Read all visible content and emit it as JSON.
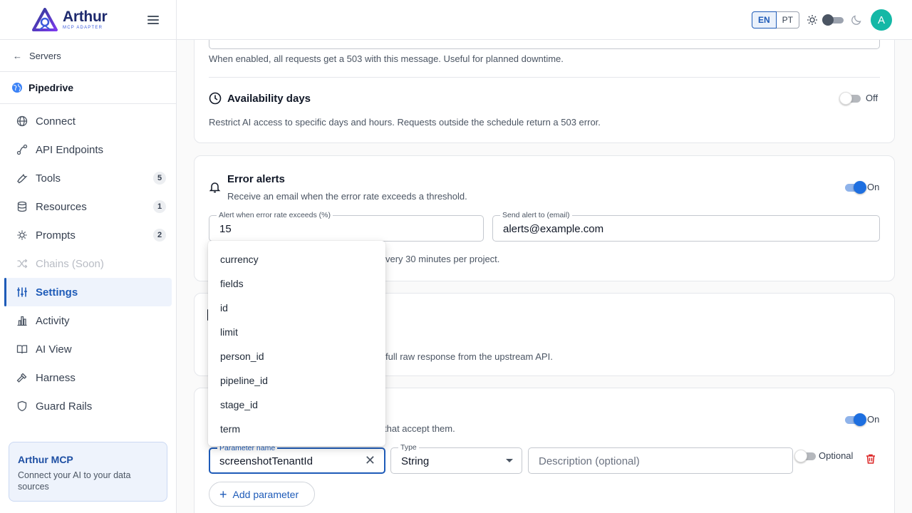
{
  "brand": {
    "title": "Arthur",
    "subtitle": "MCP ADAPTER"
  },
  "sidebar": {
    "back_label": "Servers",
    "server_name": "Pipedrive",
    "items": [
      {
        "label": "Connect",
        "icon": "globe-icon"
      },
      {
        "label": "API Endpoints",
        "icon": "endpoints-icon"
      },
      {
        "label": "Tools",
        "icon": "wrench-icon",
        "badge": "5"
      },
      {
        "label": "Resources",
        "icon": "database-icon",
        "badge": "1"
      },
      {
        "label": "Prompts",
        "icon": "lightbulb-icon",
        "badge": "2"
      },
      {
        "label": "Chains (Soon)",
        "icon": "shuffle-icon",
        "disabled": true
      },
      {
        "label": "Settings",
        "icon": "sliders-icon",
        "active": true
      },
      {
        "label": "Activity",
        "icon": "bar-chart-icon"
      },
      {
        "label": "AI View",
        "icon": "book-icon"
      },
      {
        "label": "Harness",
        "icon": "hammer-icon"
      },
      {
        "label": "Guard Rails",
        "icon": "shield-icon"
      }
    ],
    "promo": {
      "title": "Arthur MCP",
      "text": "Connect your AI to your data sources"
    }
  },
  "topbar": {
    "lang_en": "EN",
    "lang_pt": "PT",
    "avatar_letter": "A"
  },
  "maintenance": {
    "helper": "When enabled, all requests get a 503 with this message. Useful for planned downtime."
  },
  "availability": {
    "title": "Availability days",
    "helper": "Restrict AI access to specific days and hours. Requests outside the schedule return a 503 error.",
    "state": "Off"
  },
  "error_alerts": {
    "title": "Error alerts",
    "subtitle": "Receive an email when the error rate exceeds a threshold.",
    "state": "On",
    "threshold_label": "Alert when error rate exceeds (%)",
    "threshold_value": "15",
    "email_label": "Send alert to (email)",
    "email_value": "alerts@example.com",
    "footer_partial": "very 30 minutes per project."
  },
  "raw_response": {
    "helper_partial": "full raw response from the upstream API."
  },
  "params_section": {
    "state": "On",
    "helper_partial": "that accept them.",
    "param_name_label": "Parameter name",
    "param_name_value": "screenshotTenantId",
    "type_label": "Type",
    "type_value": "String",
    "description_placeholder": "Description (optional)",
    "optional_label": "Optional",
    "add_label": "Add parameter"
  },
  "dropdown_options": [
    "currency",
    "fields",
    "id",
    "limit",
    "person_id",
    "pipeline_id",
    "stage_id",
    "term"
  ],
  "colors": {
    "accent": "#1e5bb8",
    "toggle_on": "#1e6fe0",
    "avatar": "#14b8a6",
    "danger": "#dc2626"
  }
}
